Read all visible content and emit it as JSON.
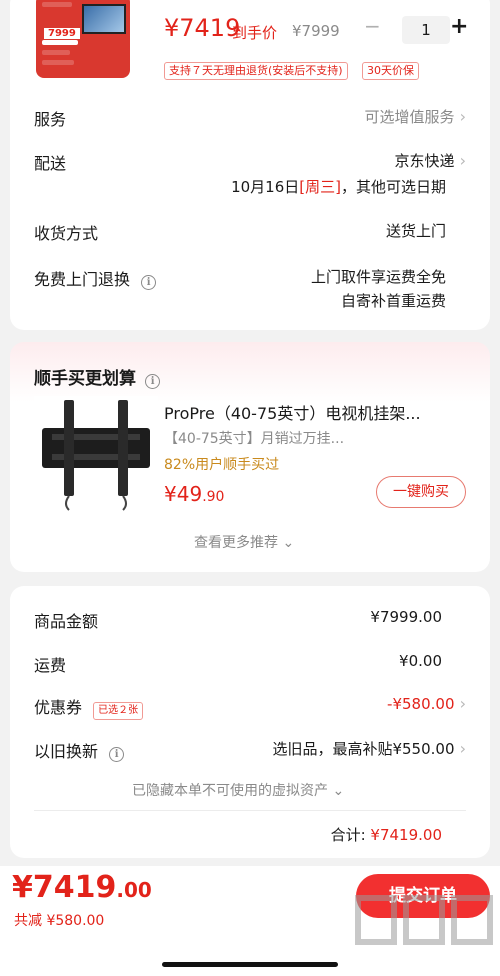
{
  "product": {
    "price": "¥7419",
    "price_suffix": "到手价",
    "orig_price": "¥7999",
    "quantity": "1",
    "minus": "−",
    "plus": "+",
    "return_tag": "支持７天无理由退货(安装后不支持)",
    "protect_tag": "30天价保",
    "thumb_badge": "7999"
  },
  "info": {
    "service_label": "服务",
    "service_value": "可选增值服务",
    "delivery_label": "配送",
    "delivery_carrier": "京东快递",
    "delivery_date": "10月16日",
    "delivery_weekday": "[周三]",
    "delivery_more": "，其他可选日期",
    "receive_label": "收货方式",
    "receive_value": "送货上门",
    "return_label": "免费上门退换",
    "return_value_1": "上门取件享运费全免",
    "return_value_2": "自寄补首重运费"
  },
  "recommend": {
    "title": "顺手买更划算",
    "item_title": "ProPre（40-75英寸）电视机挂架...",
    "item_sub": "【40-75英寸】月销过万挂...",
    "item_rate": "82%用户顺手买过",
    "item_price_int": "¥49",
    "item_price_dec": ".90",
    "buy_label": "一键购买",
    "more_label": "查看更多推荐"
  },
  "summary": {
    "goods_label": "商品金额",
    "goods_value": "¥7999.00",
    "shipping_label": "运费",
    "shipping_value": "¥0.00",
    "coupon_label": "优惠券",
    "coupon_tag": "已选２张",
    "coupon_value": "-¥580.00",
    "tradein_label": "以旧换新",
    "tradein_value": "选旧品，最高补贴¥550.00",
    "hidden_note": "已隐藏本单不可使用的虚拟资产",
    "total_label": "合计:",
    "total_value": "¥7419.00"
  },
  "bottom": {
    "price_int": "¥7419",
    "price_dec": ".00",
    "saved": "共减 ¥580.00",
    "submit": "提交订单"
  },
  "colors": {
    "accent": "#e2231a",
    "button": "#f23030",
    "background": "#f2f2f2"
  }
}
